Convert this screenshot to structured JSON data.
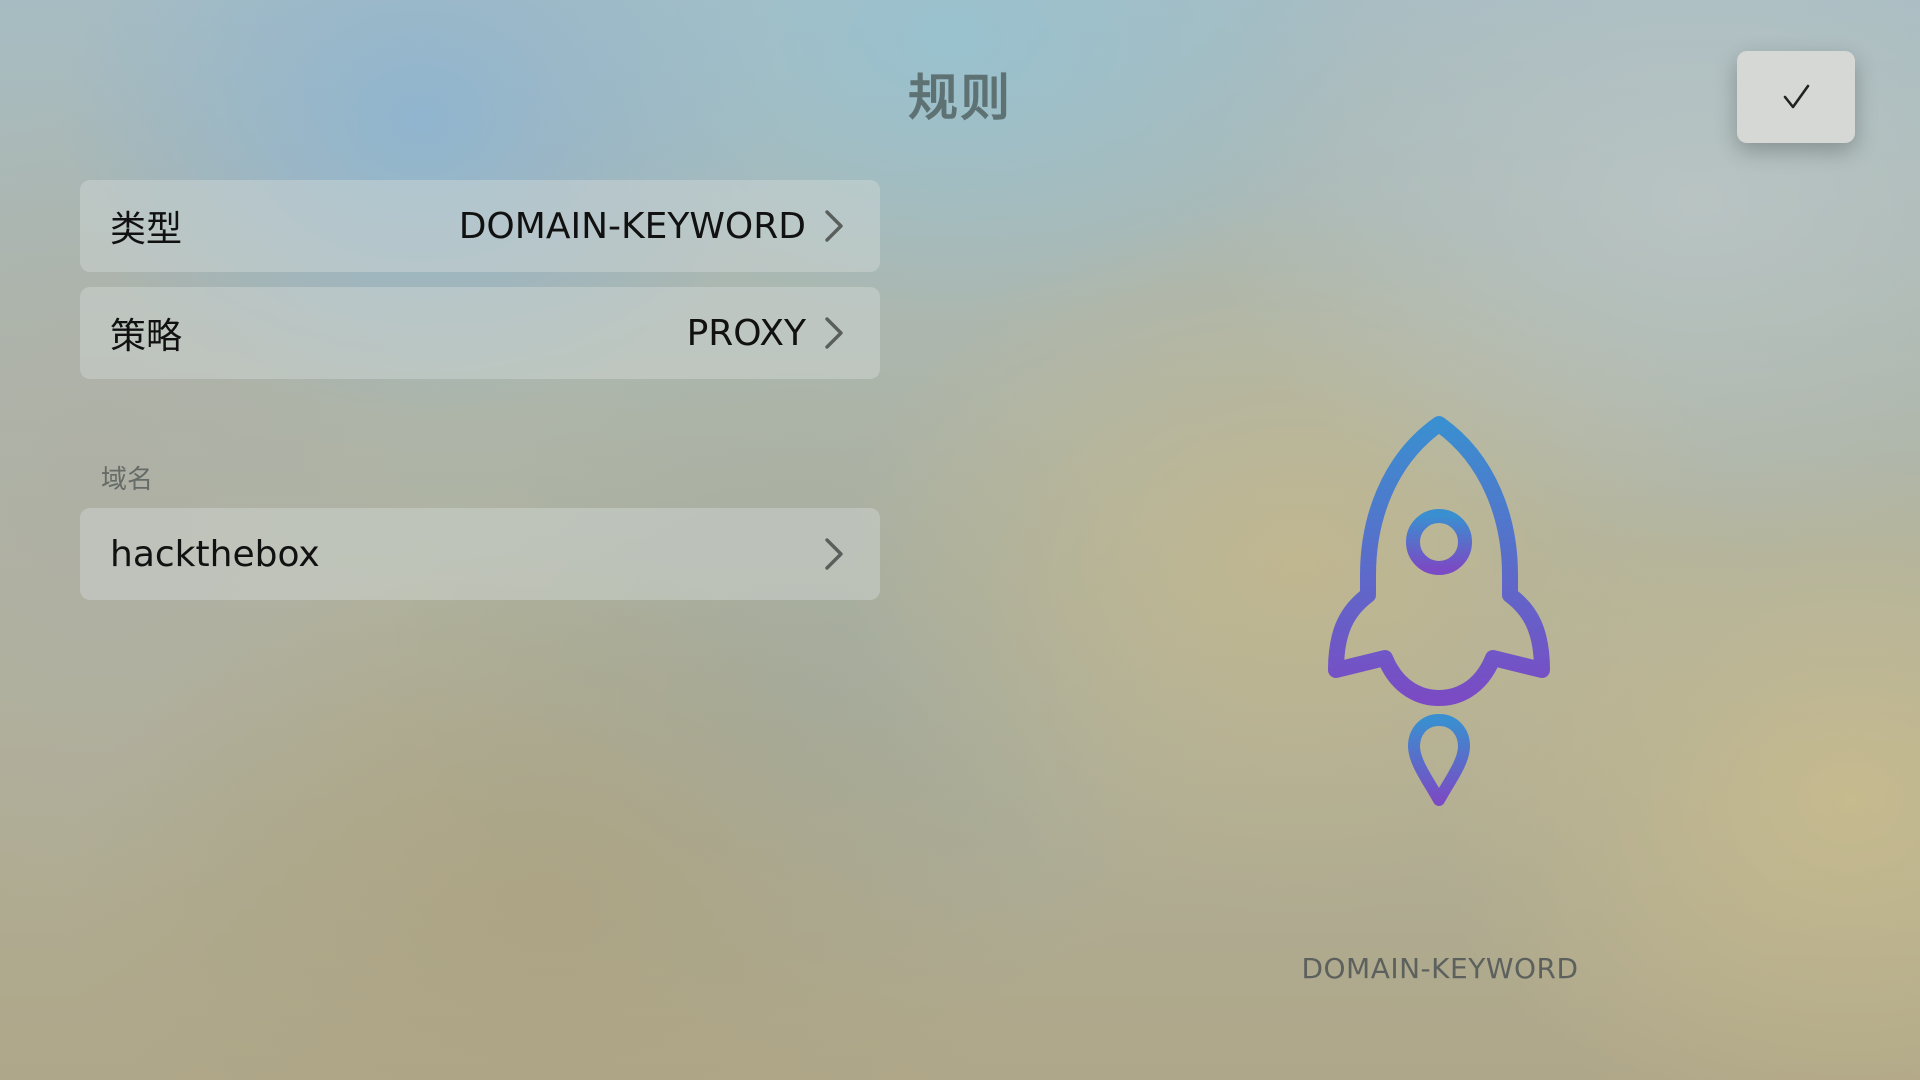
{
  "header": {
    "title": "规则",
    "done_icon": "checkmark-icon"
  },
  "rows": {
    "type": {
      "label": "类型",
      "value": "DOMAIN-KEYWORD"
    },
    "policy": {
      "label": "策略",
      "value": "PROXY"
    }
  },
  "domain_section": {
    "header": "域名",
    "value": "hackthebox"
  },
  "preview": {
    "icon": "rocket-icon",
    "caption": "DOMAIN-KEYWORD",
    "gradient_top": "#3a8fd0",
    "gradient_bottom": "#7a4bc4"
  }
}
